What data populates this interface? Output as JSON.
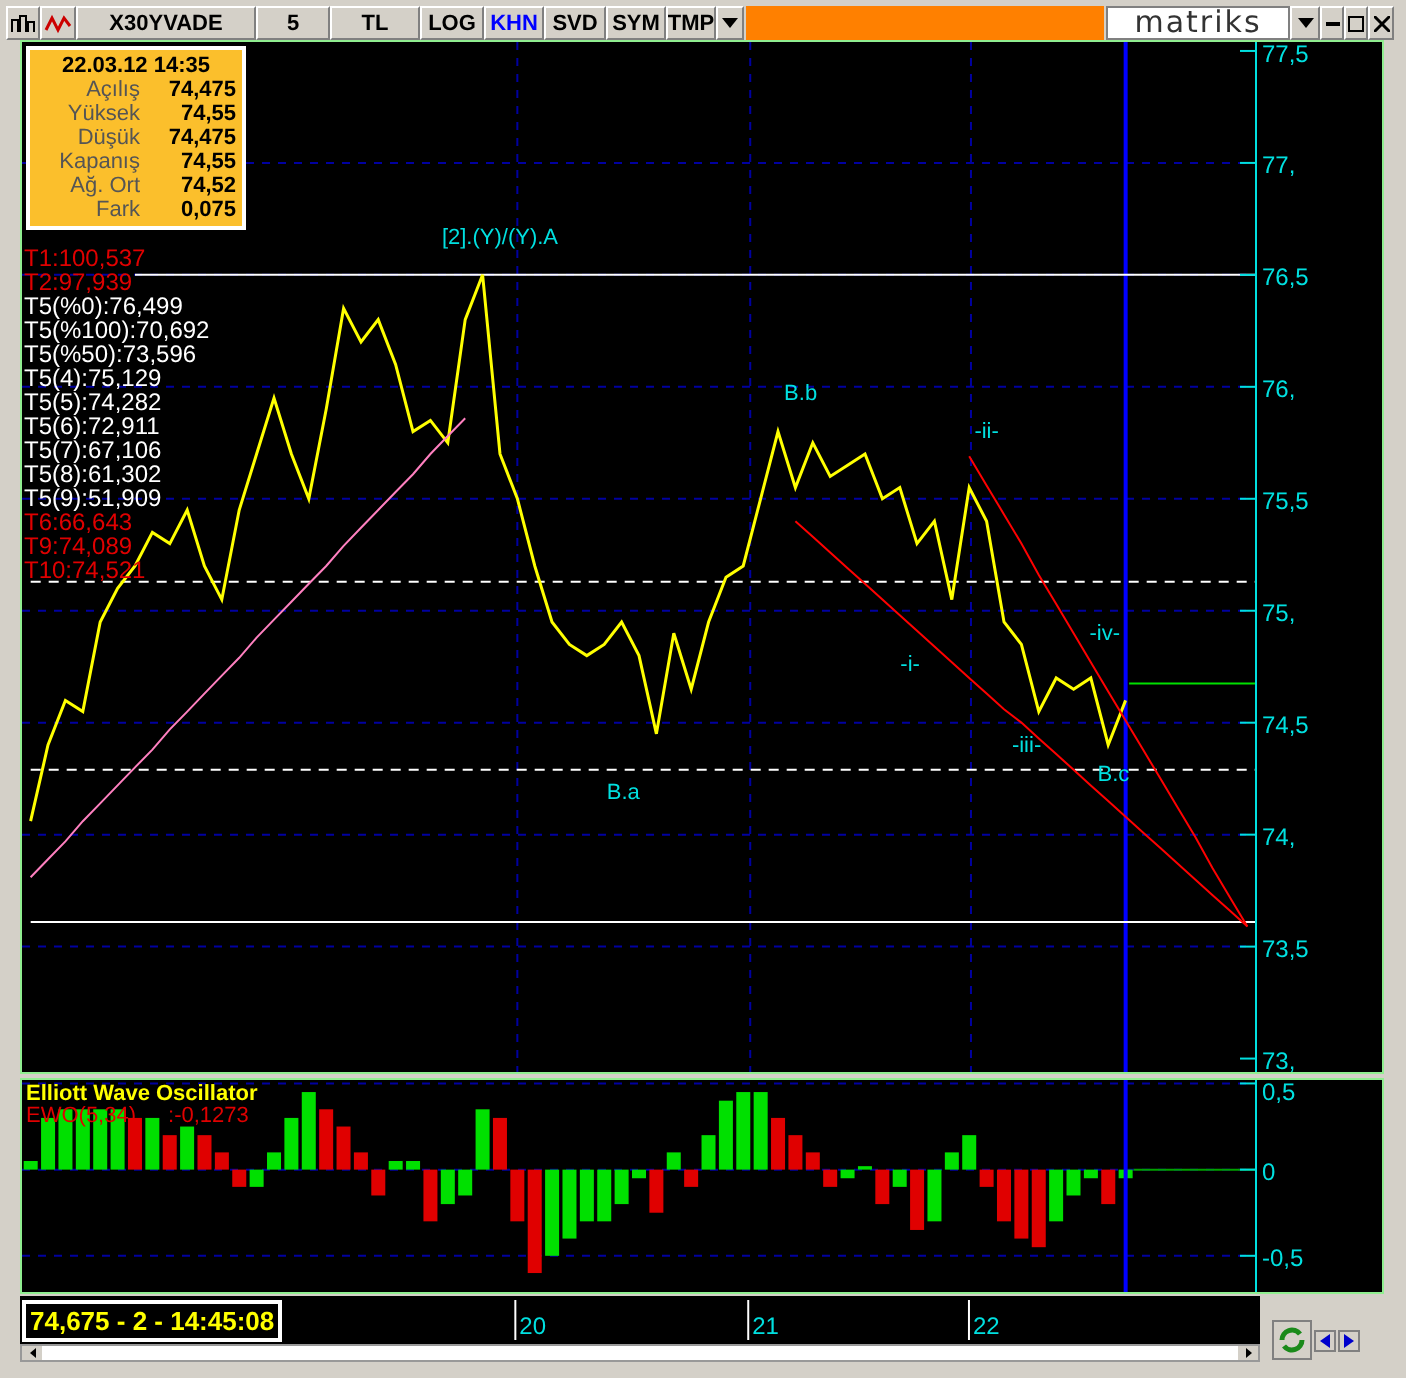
{
  "toolbar": {
    "symbol": "X30YVADE",
    "buttons": [
      {
        "label": "5",
        "selected": false
      },
      {
        "label": "TL",
        "selected": false
      },
      {
        "label": "LOG",
        "selected": false
      },
      {
        "label": "KHN",
        "selected": true
      },
      {
        "label": "SVD",
        "selected": false
      },
      {
        "label": "SYM",
        "selected": false
      },
      {
        "label": "TMP",
        "selected": false
      }
    ],
    "logo": "matriks"
  },
  "info_box": {
    "datetime": "22.03.12 14:35",
    "rows": [
      {
        "label": "Açılış",
        "value": "74,475"
      },
      {
        "label": "Yüksek",
        "value": "74,55"
      },
      {
        "label": "Düşük",
        "value": "74,475"
      },
      {
        "label": "Kapanış",
        "value": "74,55"
      },
      {
        "label": "Ağ. Ort",
        "value": "74,52"
      },
      {
        "label": "Fark",
        "value": "0,075"
      }
    ]
  },
  "levels": [
    {
      "text": "T1:100,537",
      "color": "#e00000"
    },
    {
      "text": "T2:97,939",
      "color": "#e00000"
    },
    {
      "text": "T5(%0):76,499",
      "color": "#ffffff"
    },
    {
      "text": "T5(%100):70,692",
      "color": "#ffffff"
    },
    {
      "text": "T5(%50):73,596",
      "color": "#ffffff"
    },
    {
      "text": "T5(4):75,129",
      "color": "#ffffff"
    },
    {
      "text": "T5(5):74,282",
      "color": "#ffffff"
    },
    {
      "text": "T5(6):72,911",
      "color": "#ffffff"
    },
    {
      "text": "T5(7):67,106",
      "color": "#ffffff"
    },
    {
      "text": "T5(8):61,302",
      "color": "#ffffff"
    },
    {
      "text": "T5(9):51,909",
      "color": "#ffffff"
    },
    {
      "text": "T6:66,643",
      "color": "#e00000"
    },
    {
      "text": "T9:74,089",
      "color": "#e00000"
    },
    {
      "text": "T10:74,521",
      "color": "#e00000"
    }
  ],
  "price_chart": {
    "chart_data": {
      "type": "line",
      "ylim": [
        72.94,
        77.54
      ],
      "yticks": [
        {
          "value": 77.5,
          "label": "77,5"
        },
        {
          "value": 77,
          "label": "77,"
        },
        {
          "value": 76.5,
          "label": "76,5"
        },
        {
          "value": 76,
          "label": "76,"
        },
        {
          "value": 75.5,
          "label": "75,5"
        },
        {
          "value": 75,
          "label": "75,"
        },
        {
          "value": 74.5,
          "label": "74,5"
        },
        {
          "value": 74,
          "label": "74,"
        },
        {
          "value": 73.5,
          "label": "73,5"
        },
        {
          "value": 73,
          "label": "73,"
        }
      ],
      "grid": true,
      "series": [
        {
          "color": "#ffff00",
          "values": [
            74.06,
            74.4,
            74.6,
            74.55,
            74.95,
            75.1,
            75.2,
            75.35,
            75.3,
            75.45,
            75.2,
            75.05,
            75.45,
            75.7,
            75.95,
            75.7,
            75.5,
            75.9,
            76.35,
            76.2,
            76.3,
            76.1,
            75.8,
            75.85,
            75.75,
            76.3,
            76.5,
            75.7,
            75.5,
            75.2,
            74.95,
            74.85,
            74.8,
            74.85,
            74.95,
            74.8,
            74.45,
            74.9,
            74.65,
            74.95,
            75.15,
            75.2,
            75.5,
            75.8,
            75.55,
            75.75,
            75.6,
            75.65,
            75.7,
            75.5,
            75.55,
            75.3,
            75.4,
            75.05,
            75.55,
            75.4,
            74.95,
            74.85,
            74.55,
            74.7,
            74.65,
            74.7,
            74.4,
            74.6
          ]
        },
        {
          "color": "#ff80c0",
          "values": [
            73.81,
            73.89,
            73.97,
            74.06,
            74.14,
            74.22,
            74.3,
            74.38,
            74.47,
            74.55,
            74.63,
            74.71,
            74.79,
            74.88,
            74.96,
            75.04,
            75.12,
            75.2,
            75.29,
            75.37,
            75.45,
            75.53,
            75.61,
            75.7,
            75.78,
            75.86
          ]
        },
        {
          "color": "#ff0000",
          "values": [
            null,
            null,
            null,
            null,
            null,
            null,
            null,
            null,
            null,
            null,
            null,
            null,
            null,
            null,
            null,
            null,
            null,
            null,
            null,
            null,
            null,
            null,
            null,
            null,
            null,
            null,
            null,
            null,
            null,
            null,
            null,
            null,
            null,
            null,
            null,
            null,
            null,
            null,
            null,
            null,
            null,
            null,
            null,
            null,
            75.4,
            75.33,
            75.26,
            75.19,
            75.12,
            75.05,
            74.98,
            74.91,
            74.84,
            74.77,
            74.7,
            74.63,
            74.56,
            74.5,
            74.43,
            74.36,
            74.29,
            74.22,
            74.15,
            74.08,
            74.01,
            73.94,
            73.87,
            73.8,
            73.73,
            73.66,
            73.59
          ]
        },
        {
          "color": "#ff0000",
          "values": [
            null,
            null,
            null,
            null,
            null,
            null,
            null,
            null,
            null,
            null,
            null,
            null,
            null,
            null,
            null,
            null,
            null,
            null,
            null,
            null,
            null,
            null,
            null,
            null,
            null,
            null,
            null,
            null,
            null,
            null,
            null,
            null,
            null,
            null,
            null,
            null,
            null,
            null,
            null,
            null,
            null,
            null,
            null,
            null,
            null,
            null,
            null,
            null,
            null,
            null,
            null,
            null,
            null,
            null,
            75.69,
            75.56,
            75.43,
            75.3,
            75.16,
            75.03,
            74.9,
            74.77,
            74.64,
            74.51,
            74.38,
            74.25,
            74.12,
            73.99,
            73.85,
            73.72,
            73.59
          ]
        }
      ],
      "ref_lines": [
        {
          "axis": "y",
          "value": 76.5,
          "color": "#ffffff"
        },
        {
          "axis": "y",
          "value": 75.13,
          "color": "#ffffff"
        },
        {
          "axis": "y",
          "value": 74.29,
          "color": "#ffffff"
        },
        {
          "axis": "y",
          "value": 73.61,
          "color": "#ffffff"
        },
        {
          "axis": "y",
          "value": 74.675,
          "color": "#00e000"
        }
      ],
      "annotations": [
        "[2].(Y)/(Y).A",
        "B.a",
        "B.b",
        "-ii-",
        "-i-",
        "-iv-",
        "-iii-",
        "B.c"
      ]
    }
  },
  "oscillator": {
    "title": "Elliott Wave Oscillator",
    "legend": "EWO(5,34)",
    "reading": ":-0,1273",
    "chart_data": {
      "type": "bar",
      "ylim": [
        -0.71,
        0.52
      ],
      "yticks": [
        {
          "value": 0.5,
          "label": "0,5"
        },
        {
          "value": 0,
          "label": "0"
        },
        {
          "value": -0.5,
          "label": "-0,5"
        }
      ],
      "series": [
        {
          "values": [
            0.05,
            0.3,
            0.35,
            0.35,
            0.35,
            0.35,
            0.3,
            0.3,
            0.2,
            0.25,
            0.2,
            0.1,
            -0.1,
            -0.1,
            0.1,
            0.3,
            0.45,
            0.35,
            0.25,
            0.1,
            -0.15,
            0.05,
            0.05,
            -0.3,
            -0.2,
            -0.15,
            0.35,
            0.3,
            -0.3,
            -0.6,
            -0.5,
            -0.4,
            -0.3,
            -0.3,
            -0.2,
            -0.05,
            -0.25,
            0.1,
            -0.1,
            0.2,
            0.4,
            0.45,
            0.45,
            0.3,
            0.2,
            0.1,
            -0.1,
            -0.05,
            0.02,
            -0.2,
            -0.1,
            -0.35,
            -0.3,
            0.1,
            0.2,
            -0.1,
            -0.3,
            -0.4,
            -0.45,
            -0.3,
            -0.15,
            -0.05,
            -0.2,
            -0.05,
            null,
            null,
            null,
            null,
            null,
            null,
            null
          ]
        }
      ],
      "grid": true,
      "ref_lines": [
        {
          "axis": "y",
          "value": 0,
          "color": "#00a000"
        }
      ]
    }
  },
  "time_axis": {
    "labels": [
      "20",
      "21",
      "22"
    ]
  },
  "status": {
    "text": "74,675 - 2 - 14:45:08"
  }
}
